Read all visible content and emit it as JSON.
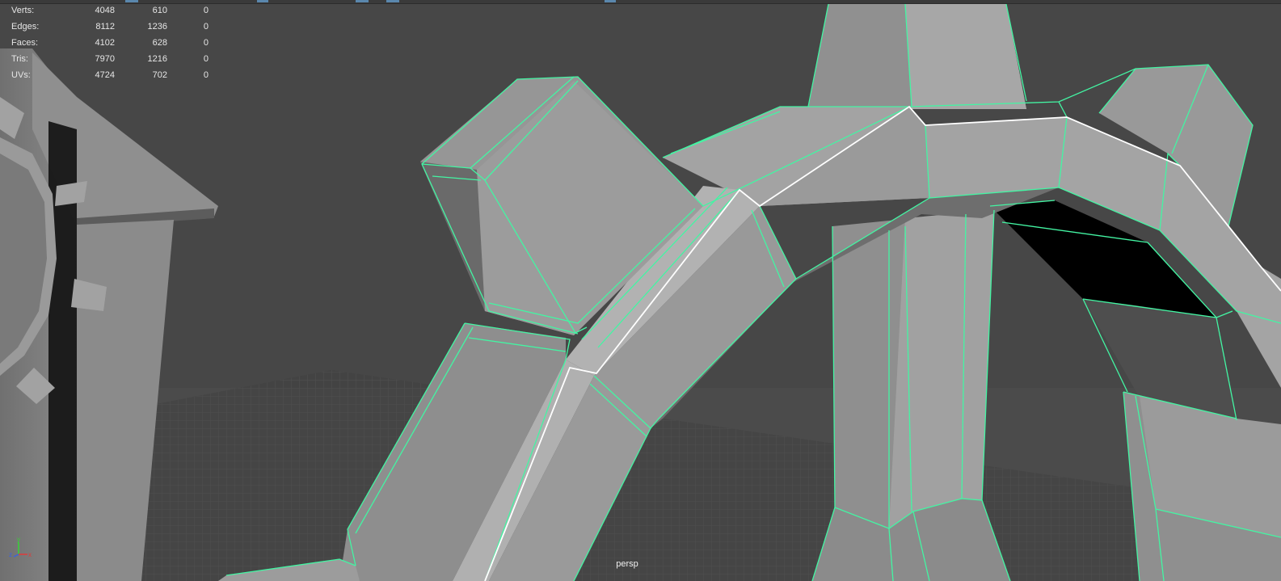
{
  "viewport": {
    "camera_name": "persp"
  },
  "hud": {
    "rows": [
      {
        "label": "Verts:",
        "total": "4048",
        "selected": "610",
        "component": "0"
      },
      {
        "label": "Edges:",
        "total": "8112",
        "selected": "1236",
        "component": "0"
      },
      {
        "label": "Faces:",
        "total": "4102",
        "selected": "628",
        "component": "0"
      },
      {
        "label": "Tris:",
        "total": "7970",
        "selected": "1216",
        "component": "0"
      },
      {
        "label": "UVs:",
        "total": "4724",
        "selected": "702",
        "component": "0"
      }
    ]
  },
  "axis_gizmo": {
    "y_label": "y",
    "z_label": "z",
    "x_label": "x"
  },
  "colors": {
    "background": "#4a4a4a",
    "wireframe_highlight": "#43f5a3",
    "selected_edge": "#ffffff",
    "mesh_gray": "#a0a0a0",
    "hud_text": "#e6e6e6"
  }
}
